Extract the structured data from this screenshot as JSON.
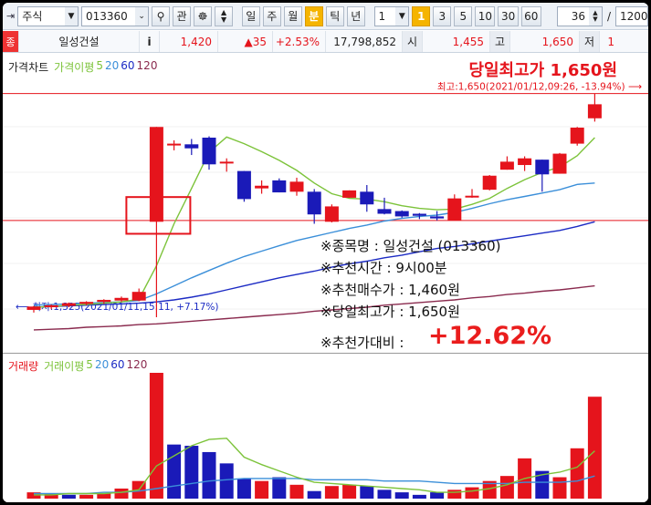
{
  "toolbar": {
    "market_select": "주식",
    "code": "013360",
    "btn_gwan": "관",
    "periods": [
      "일",
      "주",
      "월",
      "분",
      "틱",
      "년"
    ],
    "active_period": "분",
    "interval_select": "1",
    "minute_buttons": [
      "1",
      "3",
      "5",
      "10",
      "30",
      "60"
    ],
    "active_minute": "1",
    "count_value": "36",
    "divider": "/",
    "total_value": "1200"
  },
  "info_row": {
    "tag": "종",
    "name": "일성건설",
    "info_btn": "i",
    "price": "1,420",
    "change": "▲35",
    "change_pct": "+2.53%",
    "volume": "17,798,852",
    "open_label": "시",
    "open_value": "1,455",
    "high_label": "고",
    "high_value": "1,650",
    "low_label": "저",
    "low_value": "1"
  },
  "price_chart": {
    "legend": {
      "title": "가격차트",
      "ma_label": "가격이평",
      "periods": [
        "5",
        "20",
        "60",
        "120"
      ]
    },
    "headline": "당일최고가 1,650원",
    "high_marker": "최고:1,650(2021/01/12,09:26, -13.94%)",
    "low_marker": "최저:1,325(2021/01/11,15:11, +7.17%)",
    "notes": {
      "stock": "※종목명 : 일성건설 (013360)",
      "time": "※추천시간 : 9시00분",
      "buy": "※추천매수가 : 1,460원",
      "high": "※당일최고가 : 1,650원",
      "ratio_label": "※추천가대비 :",
      "ratio_value": "+12.62%"
    }
  },
  "volume_chart": {
    "legend": {
      "title": "거래량",
      "ma_label": "거래이평",
      "periods": [
        "5",
        "20",
        "60",
        "120"
      ]
    }
  },
  "colors": {
    "up": "#e5141c",
    "down": "#1a1ab8",
    "ma5": "#7cc33a",
    "ma20": "#3b8fd9",
    "ma60": "#1c2bc4",
    "ma120": "#8a2a4e"
  },
  "chart_data": {
    "type": "candlestick",
    "price_candles": [
      {
        "o": 1326,
        "h": 1332,
        "l": 1322,
        "c": 1331
      },
      {
        "o": 1330,
        "h": 1334,
        "l": 1327,
        "c": 1333
      },
      {
        "o": 1332,
        "h": 1337,
        "l": 1330,
        "c": 1336
      },
      {
        "o": 1335,
        "h": 1339,
        "l": 1333,
        "c": 1338
      },
      {
        "o": 1338,
        "h": 1342,
        "l": 1335,
        "c": 1341
      },
      {
        "o": 1340,
        "h": 1346,
        "l": 1338,
        "c": 1344
      },
      {
        "o": 1340,
        "h": 1358,
        "l": 1339,
        "c": 1353
      },
      {
        "o": 1458,
        "h": 1600,
        "l": 1315,
        "c": 1600
      },
      {
        "o": 1575,
        "h": 1580,
        "l": 1565,
        "c": 1575
      },
      {
        "o": 1574,
        "h": 1582,
        "l": 1558,
        "c": 1568
      },
      {
        "o": 1584,
        "h": 1586,
        "l": 1536,
        "c": 1544
      },
      {
        "o": 1548,
        "h": 1553,
        "l": 1533,
        "c": 1548
      },
      {
        "o": 1534,
        "h": 1534,
        "l": 1488,
        "c": 1492
      },
      {
        "o": 1508,
        "h": 1520,
        "l": 1500,
        "c": 1512
      },
      {
        "o": 1520,
        "h": 1523,
        "l": 1502,
        "c": 1502
      },
      {
        "o": 1503,
        "h": 1524,
        "l": 1497,
        "c": 1518
      },
      {
        "o": 1503,
        "h": 1507,
        "l": 1455,
        "c": 1469
      },
      {
        "o": 1458,
        "h": 1484,
        "l": 1457,
        "c": 1481
      },
      {
        "o": 1494,
        "h": 1505,
        "l": 1494,
        "c": 1505
      },
      {
        "o": 1503,
        "h": 1513,
        "l": 1473,
        "c": 1484
      },
      {
        "o": 1477,
        "h": 1494,
        "l": 1469,
        "c": 1470
      },
      {
        "o": 1474,
        "h": 1475,
        "l": 1464,
        "c": 1466
      },
      {
        "o": 1470,
        "h": 1471,
        "l": 1462,
        "c": 1467
      },
      {
        "o": 1466,
        "h": 1474,
        "l": 1460,
        "c": 1463
      },
      {
        "o": 1460,
        "h": 1499,
        "l": 1460,
        "c": 1493
      },
      {
        "o": 1497,
        "h": 1507,
        "l": 1494,
        "c": 1497
      },
      {
        "o": 1506,
        "h": 1528,
        "l": 1505,
        "c": 1527
      },
      {
        "o": 1536,
        "h": 1556,
        "l": 1536,
        "c": 1548
      },
      {
        "o": 1543,
        "h": 1556,
        "l": 1534,
        "c": 1553
      },
      {
        "o": 1551,
        "h": 1551,
        "l": 1503,
        "c": 1529
      },
      {
        "o": 1530,
        "h": 1561,
        "l": 1530,
        "c": 1560
      },
      {
        "o": 1575,
        "h": 1600,
        "l": 1572,
        "c": 1599
      },
      {
        "o": 1613,
        "h": 1650,
        "l": 1608,
        "c": 1634
      }
    ],
    "ma5": [
      1330,
      1331,
      1333,
      1334,
      1336,
      1338,
      1342,
      1392,
      1455,
      1508,
      1562,
      1585,
      1575,
      1563,
      1550,
      1535,
      1516,
      1500,
      1493,
      1492,
      1488,
      1482,
      1478,
      1476,
      1477,
      1484,
      1493,
      1508,
      1521,
      1532,
      1540,
      1557,
      1584
    ],
    "ma20": [
      1333,
      1334,
      1335,
      1336,
      1337,
      1338,
      1340,
      1350,
      1362,
      1374,
      1385,
      1396,
      1406,
      1414,
      1422,
      1430,
      1436,
      1442,
      1448,
      1453,
      1459,
      1463,
      1466,
      1468,
      1472,
      1478,
      1485,
      1491,
      1496,
      1501,
      1506,
      1514,
      1516
    ],
    "ma60": [
      1330,
      1331,
      1332,
      1333,
      1334,
      1335,
      1336,
      1338,
      1341,
      1345,
      1350,
      1356,
      1362,
      1368,
      1374,
      1379,
      1384,
      1390,
      1395,
      1399,
      1404,
      1408,
      1413,
      1418,
      1421,
      1425,
      1429,
      1433,
      1437,
      1441,
      1445,
      1451,
      1458
    ],
    "ma120": [
      1296,
      1297,
      1298,
      1300,
      1301,
      1302,
      1304,
      1305,
      1307,
      1309,
      1311,
      1313,
      1315,
      1317,
      1319,
      1321,
      1324,
      1326,
      1328,
      1330,
      1333,
      1335,
      1337,
      1339,
      1341,
      1344,
      1346,
      1349,
      1351,
      1354,
      1356,
      1359,
      1362
    ],
    "reference_lines": {
      "high": 1650,
      "buy": 1460
    },
    "volume": [
      {
        "v": 5,
        "up": true
      },
      {
        "v": 4,
        "up": true
      },
      {
        "v": 3,
        "up": false
      },
      {
        "v": 3,
        "up": true
      },
      {
        "v": 4,
        "up": true
      },
      {
        "v": 8,
        "up": true
      },
      {
        "v": 14,
        "up": true
      },
      {
        "v": 100,
        "up": true
      },
      {
        "v": 43,
        "up": false
      },
      {
        "v": 42,
        "up": false
      },
      {
        "v": 37,
        "up": false
      },
      {
        "v": 28,
        "up": false
      },
      {
        "v": 16,
        "up": false
      },
      {
        "v": 14,
        "up": true
      },
      {
        "v": 17,
        "up": false
      },
      {
        "v": 11,
        "up": true
      },
      {
        "v": 6,
        "up": false
      },
      {
        "v": 10,
        "up": true
      },
      {
        "v": 11,
        "up": true
      },
      {
        "v": 10,
        "up": false
      },
      {
        "v": 7,
        "up": false
      },
      {
        "v": 5,
        "up": false
      },
      {
        "v": 3,
        "up": false
      },
      {
        "v": 5,
        "up": false
      },
      {
        "v": 7,
        "up": true
      },
      {
        "v": 9,
        "up": true
      },
      {
        "v": 14,
        "up": true
      },
      {
        "v": 18,
        "up": true
      },
      {
        "v": 32,
        "up": true
      },
      {
        "v": 22,
        "up": false
      },
      {
        "v": 17,
        "up": true
      },
      {
        "v": 40,
        "up": true
      },
      {
        "v": 81,
        "up": true
      }
    ],
    "volume_ma5": [
      3,
      3,
      4,
      4,
      4,
      5,
      7,
      26,
      34,
      42,
      47,
      48,
      33,
      27,
      22,
      17,
      13,
      12,
      11,
      10,
      9,
      8,
      7,
      5,
      5,
      6,
      8,
      11,
      16,
      19,
      21,
      25,
      38
    ],
    "volume_ma20": [
      4,
      4,
      4,
      4,
      5,
      5,
      6,
      8,
      10,
      12,
      14,
      15,
      16,
      16,
      16,
      16,
      15,
      15,
      15,
      15,
      14,
      14,
      14,
      13,
      12,
      12,
      12,
      12,
      13,
      13,
      13,
      14,
      18
    ]
  }
}
